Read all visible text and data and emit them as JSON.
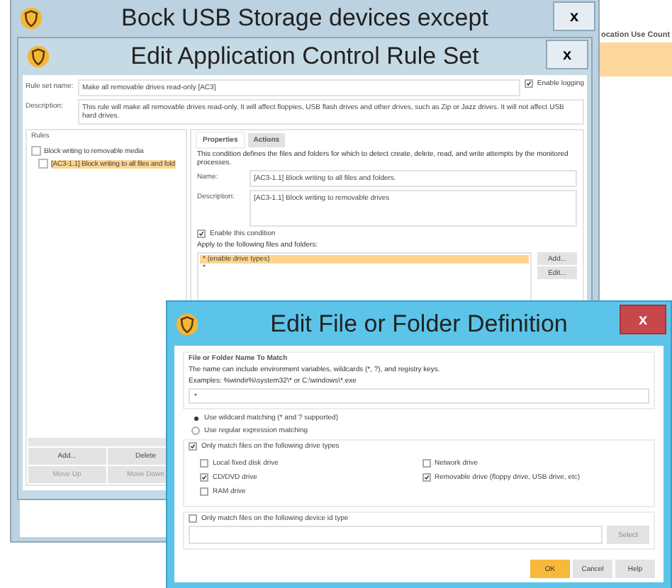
{
  "background": {
    "column_header": "ocation Use Count"
  },
  "back_window": {
    "title": "Bock USB Storage devices except",
    "close": "x"
  },
  "rule_set_window": {
    "title": "Edit Application Control Rule Set",
    "close": "x",
    "name_label": "Rule set name:",
    "name": "Make all removable drives read-only [AC3]",
    "enable_logging": {
      "label": "Enable logging",
      "checked": true
    },
    "description_label": "Description:",
    "description": "This rule will make all removable drives read-only.  It will affect floppies, USB flash drives and other drives, such as Zip or Jazz drives.  It will not affect USB hard drives.",
    "rules": {
      "label": "Rules",
      "tree": [
        {
          "label": "Block writing to removable media",
          "selected": false,
          "children": [
            {
              "label": "[AC3-1.1] Block writing to all files and fold",
              "selected": true
            }
          ]
        }
      ],
      "buttons": [
        {
          "label": "Add...",
          "disabled": false
        },
        {
          "label": "Delete",
          "disabled": false
        },
        {
          "label": "Move Up",
          "disabled": true
        },
        {
          "label": "Move Down",
          "disabled": true
        }
      ]
    },
    "tabs": [
      {
        "label": "Properties",
        "selected": true
      },
      {
        "label": "Actions",
        "selected": false
      }
    ],
    "condition_text": "This condition defines the files and folders for which to detect create, delete, read, and write attempts by the monitored processes.",
    "condition_name_label": "Name:",
    "condition_name": "[AC3-1.1] Block writing to all files and folders.",
    "condition_description_label": "Description:",
    "condition_description": "[AC3-1.1] Block writing to removable drives",
    "enable_condition": {
      "label": "Enable this condition",
      "checked": true
    },
    "apply_label": "Apply to the following files and folders:",
    "files": [
      {
        "label": "* (enable drive types)",
        "selected": true
      },
      {
        "label": "*",
        "selected": false
      }
    ],
    "file_buttons": [
      "Add...",
      "Edit..."
    ]
  },
  "file_dialog": {
    "title": "Edit File or Folder Definition",
    "close": "x",
    "group_label": "File or Folder Name To Match",
    "hint": "The name can include environment variables, wildcards (*, ?), and registry keys.",
    "examples": "Examples: %windir%\\system32\\* or C:\\windows\\*.exe",
    "value": "*",
    "matching": [
      {
        "label": "Use wildcard matching (* and ? supported)",
        "selected": true
      },
      {
        "label": "Use regular expression matching",
        "selected": false
      }
    ],
    "drive_types": {
      "label": "Only match files on the following drive types",
      "checked": true,
      "drives": [
        {
          "label": "Local fixed disk drive",
          "checked": false
        },
        {
          "label": "Network drive",
          "checked": false
        },
        {
          "label": "CD/DVD drive",
          "checked": true
        },
        {
          "label": "Removable drive (floppy drive, USB drive, etc)",
          "checked": true
        },
        {
          "label": "RAM drive",
          "checked": false
        }
      ]
    },
    "device_id": {
      "label": "Only match files on the following device id type",
      "checked": false,
      "button": "Select"
    },
    "buttons": [
      {
        "label": "OK",
        "kind": "primary"
      },
      {
        "label": "Cancel",
        "kind": "normal"
      },
      {
        "label": "Help",
        "kind": "normal"
      }
    ]
  }
}
